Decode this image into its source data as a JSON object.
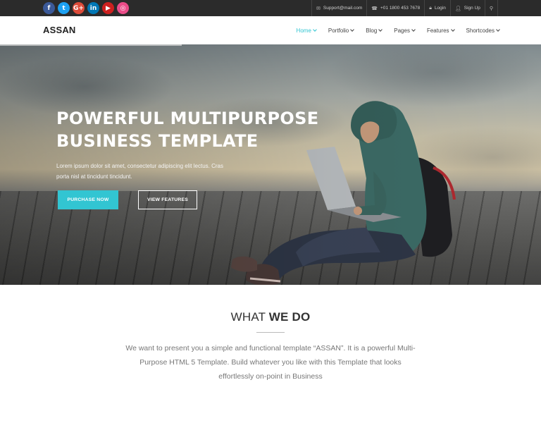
{
  "topbar": {
    "socials": [
      {
        "icon": "facebook-icon",
        "glyph": "f",
        "color": "#3b5998"
      },
      {
        "icon": "twitter-icon",
        "glyph": "t",
        "color": "#1da1f2"
      },
      {
        "icon": "google-plus-icon",
        "glyph": "G+",
        "color": "#dd4b39"
      },
      {
        "icon": "linkedin-icon",
        "glyph": "in",
        "color": "#0077b5"
      },
      {
        "icon": "youtube-icon",
        "glyph": "▶",
        "color": "#cd201f"
      },
      {
        "icon": "dribbble-icon",
        "glyph": "◎",
        "color": "#ea4c89"
      }
    ],
    "email": "Support@mail.com",
    "phone": "+01 1800 453 7678",
    "login": "Login",
    "signup": "Sign Up"
  },
  "nav": {
    "logo": "ASSAN",
    "items": [
      "Home",
      "Portfolio",
      "Blog",
      "Pages",
      "Features",
      "Shortcodes"
    ],
    "accent": "#32c5d2"
  },
  "hero": {
    "title_line1": "POWERFUL MULTIPURPOSE",
    "title_line2": "BUSINESS TEMPLATE",
    "text": "Lorem ipsum dolor sit amet, consectetur adipiscing elit lectus. Cras porta nisl at tincidunt tincidunt.",
    "purchase_label": "PURCHASE NOW",
    "features_label": "VIEW FEATURES"
  },
  "what_we_do": {
    "title_light": "WHAT ",
    "title_bold": "WE DO",
    "text": "We want to present you a simple and functional template “ASSAN”. It is a powerful Multi-Purpose HTML 5 Template. Build whatever you like with this Template that looks effortlessly on-point in Business"
  }
}
